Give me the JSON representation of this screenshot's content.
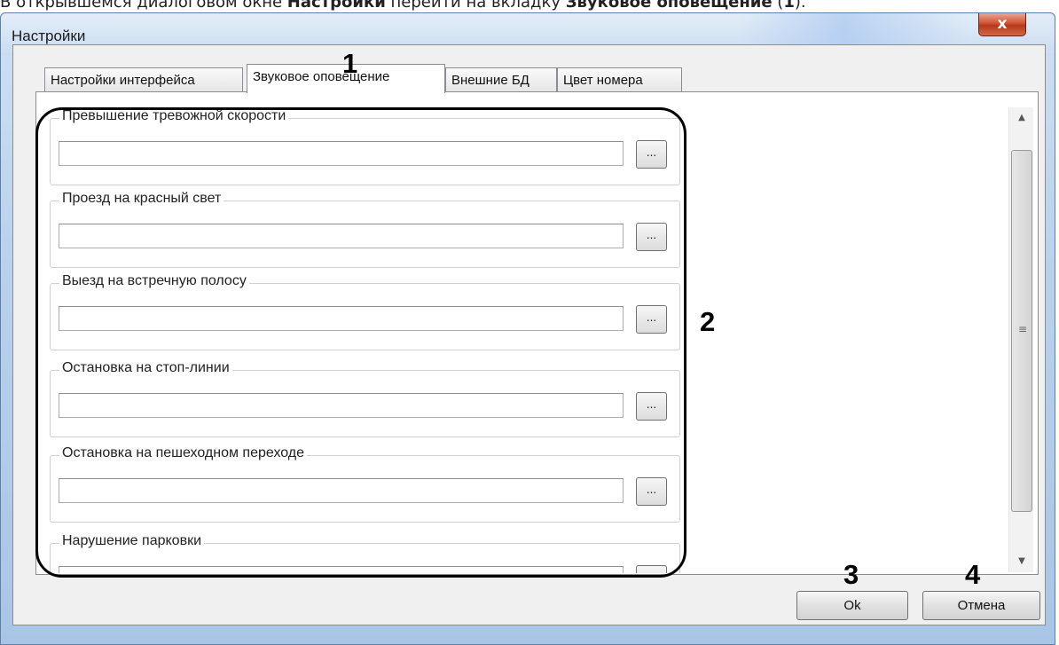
{
  "doc": {
    "prefix": "В открывшемся диалоговом окне ",
    "bold1": "Настройки",
    "middle": " перейти на вкладку ",
    "bold2": "Звуковое оповещение",
    "suffix": " (",
    "ref": "1",
    "end": ")."
  },
  "window": {
    "title": "Настройки",
    "close_label": "x"
  },
  "tabs": [
    {
      "label": "Настройки интерфейса"
    },
    {
      "label": "Звуковое оповещение"
    },
    {
      "label": "Внешние БД"
    },
    {
      "label": "Цвет номера"
    }
  ],
  "groups": [
    {
      "label": "Превышение тревожной скорости",
      "value": ""
    },
    {
      "label": "Проезд на красный свет",
      "value": ""
    },
    {
      "label": "Выезд на встречную полосу",
      "value": ""
    },
    {
      "label": "Остановка на стоп-линии",
      "value": ""
    },
    {
      "label": "Остановка на пешеходном переходе",
      "value": ""
    },
    {
      "label": "Нарушение парковки",
      "value": ""
    }
  ],
  "browse_label": "...",
  "scroll": {
    "up_glyph": "▲",
    "down_glyph": "▼",
    "grip_glyph": "≡"
  },
  "buttons": {
    "ok": "Ok",
    "cancel": "Отмена"
  },
  "callouts": {
    "tab": "1",
    "area": "2",
    "ok": "3",
    "cancel": "4"
  }
}
